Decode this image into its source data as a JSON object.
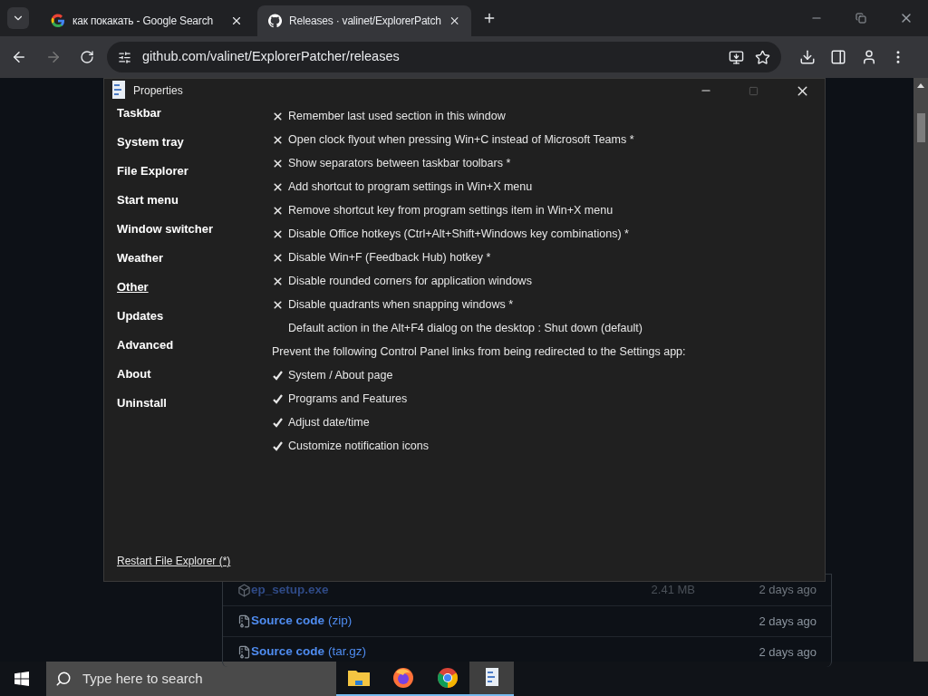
{
  "browser": {
    "tabs": [
      {
        "title": "как покакать - Google Search",
        "selected": false
      },
      {
        "title": "Releases · valinet/ExplorerPatch",
        "selected": true
      }
    ],
    "address": "github.com/valinet/ExplorerPatcher/releases"
  },
  "page": {
    "assets": [
      {
        "name": "ep_setup.exe",
        "size": "2.41 MB",
        "date": "2 days ago",
        "kind": "package"
      },
      {
        "name": "Source code",
        "suffix": "(zip)",
        "date": "2 days ago",
        "kind": "archive"
      },
      {
        "name": "Source code",
        "suffix": "(tar.gz)",
        "date": "2 days ago",
        "kind": "archive"
      }
    ]
  },
  "dialog": {
    "title": "Properties",
    "sections": [
      {
        "label": "Taskbar",
        "selected": false
      },
      {
        "label": "System tray",
        "selected": false
      },
      {
        "label": "File Explorer",
        "selected": false
      },
      {
        "label": "Start menu",
        "selected": false
      },
      {
        "label": "Window switcher",
        "selected": false
      },
      {
        "label": "Weather",
        "selected": false
      },
      {
        "label": "Other",
        "selected": true
      },
      {
        "label": "Updates",
        "selected": false
      },
      {
        "label": "Advanced",
        "selected": false
      },
      {
        "label": "About",
        "selected": false
      },
      {
        "label": "Uninstall",
        "selected": false
      }
    ],
    "settings": [
      {
        "kind": "toggle",
        "label": "Remember last used section in this window",
        "checked": false
      },
      {
        "kind": "toggle",
        "label": "Open clock flyout when pressing Win+C instead of Microsoft Teams *",
        "checked": false
      },
      {
        "kind": "toggle",
        "label": "Show separators between taskbar toolbars *",
        "checked": false
      },
      {
        "kind": "toggle",
        "label": "Add shortcut to program settings in Win+X menu",
        "checked": false
      },
      {
        "kind": "toggle",
        "label": "Remove shortcut key from program settings item in Win+X menu",
        "checked": false
      },
      {
        "kind": "toggle",
        "label": "Disable Office hotkeys (Ctrl+Alt+Shift+Windows key combinations) *",
        "checked": false
      },
      {
        "kind": "toggle",
        "label": "Disable Win+F (Feedback Hub) hotkey *",
        "checked": false
      },
      {
        "kind": "toggle",
        "label": "Disable rounded corners for application windows",
        "checked": false
      },
      {
        "kind": "toggle",
        "label": "Disable quadrants when snapping windows *",
        "checked": false
      },
      {
        "kind": "option",
        "label": "Default action in the Alt+F4 dialog on the desktop : Shut down (default)"
      },
      {
        "kind": "heading",
        "label": "Prevent the following Control Panel links from being redirected to the Settings app:"
      },
      {
        "kind": "toggle",
        "label": "System / About page",
        "checked": true
      },
      {
        "kind": "toggle",
        "label": "Programs and Features",
        "checked": true
      },
      {
        "kind": "toggle",
        "label": "Adjust date/time",
        "checked": true
      },
      {
        "kind": "toggle",
        "label": "Customize notification icons",
        "checked": true
      }
    ],
    "footer_link": "Restart File Explorer (*)"
  },
  "taskbar": {
    "search_placeholder": "Type here to search",
    "apps": [
      {
        "kind": "folder",
        "selected": false
      },
      {
        "kind": "firefox",
        "selected": false
      },
      {
        "kind": "chrome",
        "selected": false
      },
      {
        "kind": "properties",
        "selected": true
      }
    ]
  }
}
